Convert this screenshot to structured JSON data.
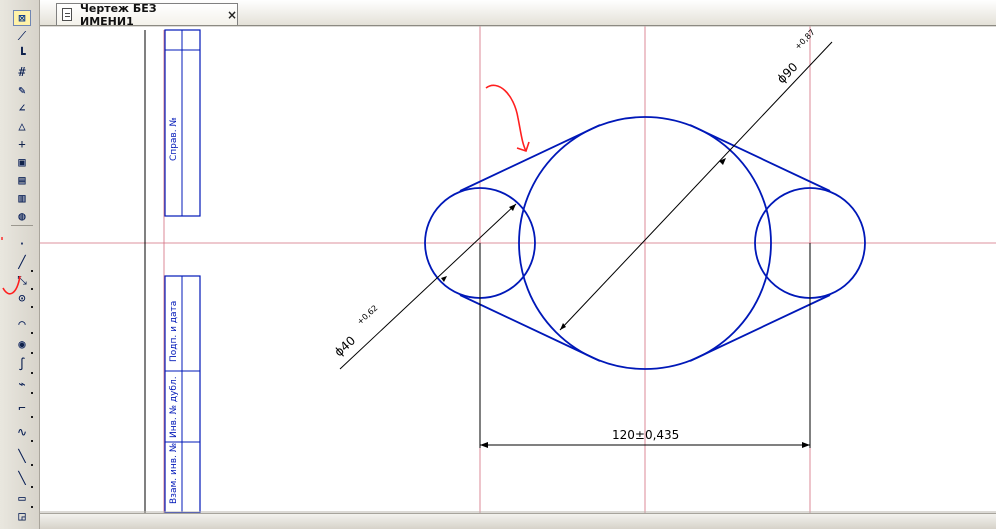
{
  "tab": {
    "title": "Чертеж БЕЗ ИМЕНИ1",
    "close": "×"
  },
  "titleblock": {
    "sprav": "Справ. №",
    "podp_data": "Подп. и дата",
    "inv_dubl": "Инв. № дубл.",
    "vzam_inv": "Взам. инв. №"
  },
  "dimensions": {
    "diameter_90": "ϕ90",
    "diameter_90_tol": "+0,87",
    "diameter_40": "ϕ40",
    "diameter_40_tol": "+0,62",
    "center_distance": "120±0,435"
  },
  "toolbar": {
    "icons": [
      "select-icon",
      "line-icon",
      "dimension-icon",
      "grid-icon",
      "pen-icon",
      "angle-icon",
      "triangle-icon",
      "point-icon",
      "frame-icon",
      "sheet-icon",
      "sheet2-icon",
      "view-icon",
      "pin-icon",
      "dot-icon",
      "line-slant-icon",
      "circle-tangent-icon",
      "circle-icon",
      "arc-icon",
      "ellipse-icon",
      "curve-icon",
      "fillet-icon",
      "chamfer-icon",
      "spline-icon",
      "polyline-icon",
      "equidistant-icon",
      "rectangle-icon",
      "contour-icon"
    ]
  },
  "colors": {
    "blue": "#0018b8",
    "red_center": "#d36b7d",
    "red_annotation": "#ff1f1f",
    "black": "#000000"
  }
}
